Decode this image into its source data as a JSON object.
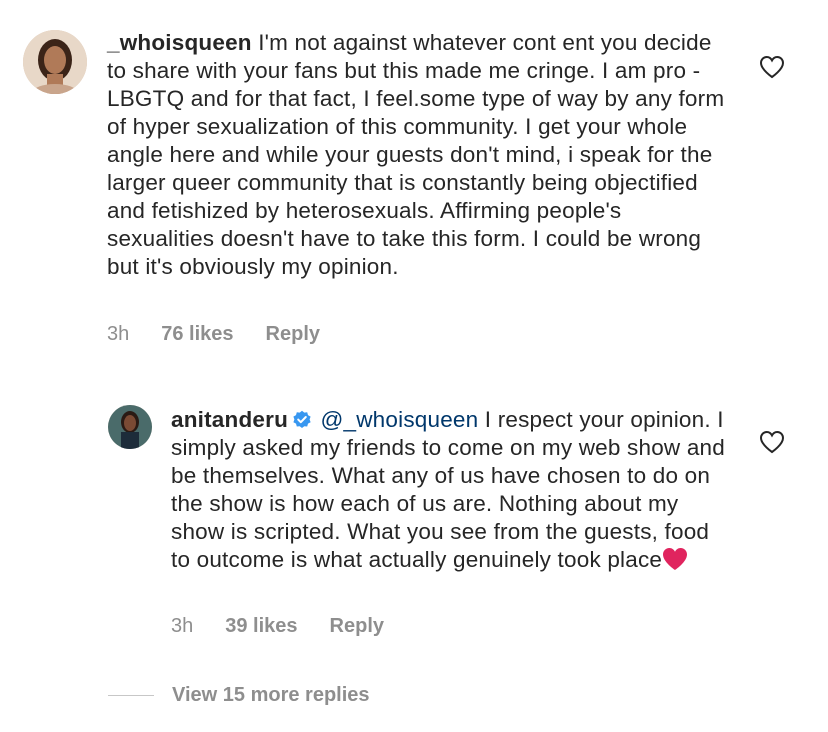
{
  "comment": {
    "username": "_whoisqueen",
    "text": "I'm not against whatever cont ent you decide to share with your fans but this made me cringe. I am pro - LBGTQ and for that fact, I feel.some type of way by any form of hyper sexualization of this community. I get your whole angle here and while your guests don't mind, i speak for the larger queer community that is constantly being objectified and fetishized by heterosexuals. Affirming people's sexualities doesn't have to take this form. I could be wrong but it's obviously my opinion.",
    "time": "3h",
    "likes": "76 likes",
    "reply_label": "Reply"
  },
  "reply": {
    "username": "anitanderu",
    "mention": "@_whoisqueen",
    "text": "I respect your opinion. I simply asked my friends to come on my web show and be themselves. What any of us have chosen to do on the show is how each of us are. Nothing about my show is scripted. What you see from the guests, food to outcome is what actually genuinely took place",
    "time": "3h",
    "likes": "39 likes",
    "reply_label": "Reply"
  },
  "view_more": "View 15 more replies",
  "colors": {
    "text": "#262626",
    "meta": "#8e8e8e",
    "mention": "#00376b",
    "verified": "#3897f0",
    "heart_emoji": "#e0245e"
  },
  "icons": [
    "avatar-whoisqueen",
    "avatar-anitanderu",
    "verified-badge-icon",
    "like-heart-icon",
    "red-heart-emoji"
  ]
}
